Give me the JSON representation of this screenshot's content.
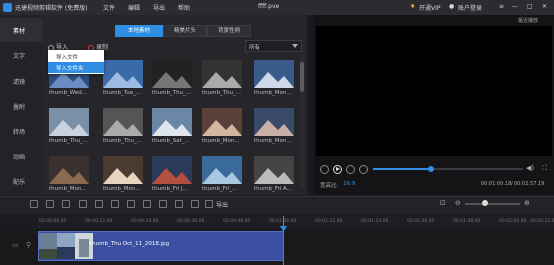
{
  "titlebar": {
    "app_name": "迅捷视频剪辑软件 (免费版)",
    "menus": [
      "文件",
      "编辑",
      "导出",
      "帮助"
    ],
    "document_title": "ffff.pve",
    "vip_label": "开通VIP",
    "account_label": "账户登录"
  },
  "leftnav": {
    "items": [
      {
        "label": "素材",
        "active": true
      },
      {
        "label": "文字",
        "active": false
      },
      {
        "label": "滤镜",
        "active": false
      },
      {
        "label": "叠附",
        "active": false
      },
      {
        "label": "转场",
        "active": false
      },
      {
        "label": "动画",
        "active": false
      },
      {
        "label": "配乐",
        "active": false
      }
    ]
  },
  "media": {
    "tabs": [
      {
        "label": "本地素材",
        "active": true
      },
      {
        "label": "精美片头",
        "active": false
      },
      {
        "label": "背景性例",
        "active": false
      }
    ],
    "import_label": "导入",
    "record_label": "录制",
    "filter_selected": "所有",
    "import_menu": [
      "导入文件",
      "导入文件夹"
    ],
    "thumbnails": [
      {
        "caption": "thumb_Wed...",
        "icon": "landscape-photo"
      },
      {
        "caption": "thumb_Tue_...",
        "icon": "landscape-photo"
      },
      {
        "caption": "thumb_Thu_...",
        "icon": "landscape-photo"
      },
      {
        "caption": "thumb_Thu_...",
        "icon": "landscape-photo"
      },
      {
        "caption": "thumb_Mon...",
        "icon": "landscape-photo"
      },
      {
        "caption": "thumb_Thu_...",
        "icon": "landscape-photo"
      },
      {
        "caption": "thumb_Thu_...",
        "icon": "landscape-photo"
      },
      {
        "caption": "thumb_Sat_...",
        "icon": "landscape-photo"
      },
      {
        "caption": "thumb_Mon...",
        "icon": "landscape-photo"
      },
      {
        "caption": "thumb_Mon...",
        "icon": "landscape-photo"
      },
      {
        "caption": "thumb_Mon...",
        "icon": "landscape-photo"
      },
      {
        "caption": "thumb_Mon...",
        "icon": "landscape-photo"
      },
      {
        "caption": "thumb_Fri J...",
        "icon": "landscape-photo"
      },
      {
        "caption": "thumb_Fri_...",
        "icon": "landscape-photo"
      },
      {
        "caption": "thumb_Fri A...",
        "icon": "landscape-photo"
      }
    ]
  },
  "preview": {
    "title": "最近播放",
    "ratio_label": "宽高比:",
    "ratio_value": "16:9",
    "current_time": "00:01:00.18",
    "total_time": "00:02:57.19",
    "progress_fraction": 0.38
  },
  "timeline": {
    "export_label": "导出",
    "ruler_ticks": [
      "00:00:00.00",
      "00:00:12.00",
      "00:00:24.00",
      "00:00:36.00",
      "00:00:48.00",
      "00:01:00.00",
      "00:01:12.00",
      "00:01:24.00",
      "00:01:36.00",
      "00:01:48.00",
      "00:02:00.00",
      "00:02:12.00"
    ],
    "clip_label": "thumb_Thu Oct_11_2018.jpg"
  },
  "colors": {
    "accent": "#2f8de4",
    "clip": "#3a4fa0",
    "background": "#1b1b1f"
  }
}
